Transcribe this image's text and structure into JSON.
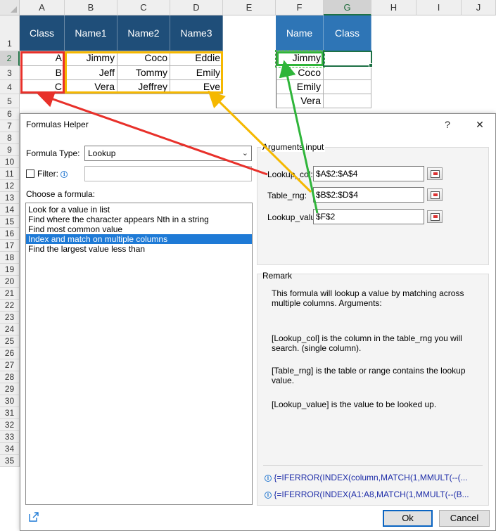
{
  "spreadsheet": {
    "columns": [
      "A",
      "B",
      "C",
      "D",
      "E",
      "F",
      "G",
      "H",
      "I",
      "J"
    ],
    "rows": [
      "1",
      "2",
      "3",
      "4",
      "5",
      "6",
      "7",
      "8",
      "9",
      "10",
      "11",
      "12",
      "13",
      "14",
      "15",
      "16",
      "17",
      "18",
      "19",
      "20",
      "21",
      "22",
      "23",
      "24",
      "25",
      "26",
      "27",
      "28",
      "29",
      "30",
      "31",
      "32",
      "33",
      "34",
      "35"
    ],
    "table1": {
      "headers": [
        "Class",
        "Name1",
        "Name2",
        "Name3"
      ],
      "rows": [
        [
          "A",
          "Jimmy",
          "Coco",
          "Eddie"
        ],
        [
          "B",
          "Jeff",
          "Tommy",
          "Emily"
        ],
        [
          "C",
          "Vera",
          "Jeffrey",
          "Eve"
        ]
      ]
    },
    "table2": {
      "headers": [
        "Name",
        "Class"
      ],
      "rows": [
        [
          "Jimmy",
          ""
        ],
        [
          "Coco",
          ""
        ],
        [
          "Emily",
          ""
        ],
        [
          "Vera",
          ""
        ]
      ]
    },
    "colors": {
      "header_dark": "#1f4e79",
      "header_light": "#2e75b6",
      "red_arrow": "#e8302a",
      "orange_arrow": "#f5b800",
      "green_arrow": "#2fb53a"
    }
  },
  "dialog": {
    "title": "Formulas Helper",
    "help_label": "?",
    "close_label": "✕",
    "formula_type_label": "Formula Type:",
    "formula_type_value": "Lookup",
    "filter_label": "Filter:",
    "choose_label": "Choose a formula:",
    "formulas": [
      "Look for a value in list",
      "Find where the character appears Nth in a string",
      "Find most common value",
      "Index and match on multiple columns",
      "Find the largest value less than"
    ],
    "selected_index": 3,
    "arguments_title": "Arguments input",
    "arguments": [
      {
        "label": "Lookup_col:",
        "value": "$A$2:$A$4"
      },
      {
        "label": "Table_rng:",
        "value": "$B$2:$D$4"
      },
      {
        "label": "Lookup_value:",
        "value": "$F$2"
      }
    ],
    "remark_title": "Remark",
    "remark_paragraphs": [
      "This formula will lookup a value by matching across multiple columns. Arguments:",
      "[Lookup_col] is the column in the table_rng you will search. (single column).",
      "[Table_rng] is the table or range contains the lookup value.",
      "[Lookup_value] is the value to be looked up."
    ],
    "formula_examples": [
      "{=IFERROR(INDEX(column,MATCH(1,MMULT(--(...",
      "{=IFERROR(INDEX(A1:A8,MATCH(1,MMULT(--(B..."
    ],
    "ok_label": "Ok",
    "cancel_label": "Cancel"
  }
}
